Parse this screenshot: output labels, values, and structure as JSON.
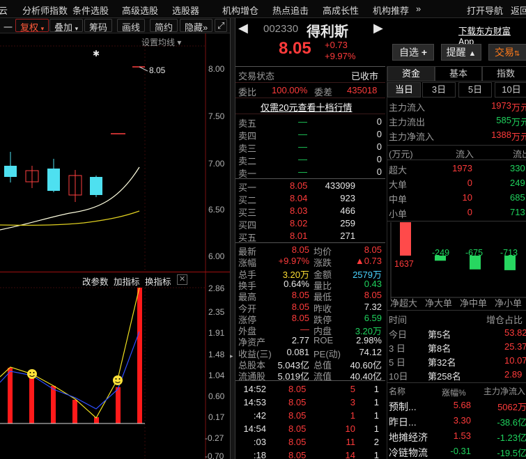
{
  "menu": {
    "items": [
      "云",
      "分析师指数",
      "条件选股",
      "高级选股",
      "选股器",
      "机构增仓",
      "热点追击",
      "高成长性",
      "机构推荐",
      "»",
      "打开导航",
      "返回"
    ]
  },
  "toolbar": {
    "buttons": [
      "复权",
      "叠加",
      "筹码",
      "画线",
      "简约",
      "隐藏"
    ],
    "first_glyph": "一",
    "expand_arrow": "»",
    "fullscreen_icon": "⤢"
  },
  "kline": {
    "setting_label": "设置均线",
    "star": "✱",
    "price_marker": "8.05",
    "y_ticks": [
      "8.00",
      "7.50",
      "7.00",
      "6.50",
      "6.00"
    ]
  },
  "indicator": {
    "buttons": [
      "改参数",
      "加指标",
      "换指标"
    ],
    "close_icon": "✕",
    "y_ticks": [
      "2.86",
      "2.35",
      "1.91",
      "1.48",
      "1.04",
      "0.60",
      "0.17",
      "-0.27",
      "-0.70"
    ]
  },
  "stock": {
    "code": "002330",
    "name": "得利斯",
    "price": "8.05",
    "change": "+0.73",
    "change_pct": "+9.97%",
    "add_watch": "自选",
    "add_watch_icon": "+",
    "remind": "提醒",
    "remind_icon": "🔔",
    "trade": "交易",
    "download_link": "下载东方财富App",
    "prev_arrow": "◀",
    "next_arrow": "▶"
  },
  "status": {
    "label": "交易状态",
    "value": "已收市",
    "weibi_label": "委比",
    "weibi": "100.00%",
    "weicha_label": "委差",
    "weicha": "435018",
    "promo": "仅需20元查看十档行情"
  },
  "asks": [
    {
      "label": "卖五",
      "price": "—",
      "vol": "0"
    },
    {
      "label": "卖四",
      "price": "—",
      "vol": "0"
    },
    {
      "label": "卖三",
      "price": "—",
      "vol": "0"
    },
    {
      "label": "卖二",
      "price": "—",
      "vol": "0"
    },
    {
      "label": "卖一",
      "price": "—",
      "vol": "0"
    }
  ],
  "bids": [
    {
      "label": "买一",
      "price": "8.05",
      "vol": "433099"
    },
    {
      "label": "买二",
      "price": "8.04",
      "vol": "923"
    },
    {
      "label": "买三",
      "price": "8.03",
      "vol": "466"
    },
    {
      "label": "买四",
      "price": "8.02",
      "vol": "259"
    },
    {
      "label": "买五",
      "price": "8.01",
      "vol": "271"
    }
  ],
  "stats": [
    {
      "l1": "最新",
      "v1": "8.05",
      "c1": "red",
      "l2": "均价",
      "v2": "8.05",
      "c2": "red"
    },
    {
      "l1": "涨幅",
      "v1": "+9.97%",
      "c1": "red",
      "l2": "涨跌",
      "v2": "▲0.73",
      "c2": "red"
    },
    {
      "l1": "总手",
      "v1": "3.20万",
      "c1": "yellow",
      "l2": "金额",
      "v2": "2579万",
      "c2": "cyan"
    },
    {
      "l1": "换手",
      "v1": "0.64%",
      "c1": "white",
      "l2": "量比",
      "v2": "0.43",
      "c2": "green"
    },
    {
      "l1": "最高",
      "v1": "8.05",
      "c1": "red",
      "l2": "最低",
      "v2": "8.05",
      "c2": "red"
    },
    {
      "l1": "今开",
      "v1": "8.05",
      "c1": "red",
      "l2": "昨收",
      "v2": "7.32",
      "c2": "white"
    },
    {
      "l1": "涨停",
      "v1": "8.05",
      "c1": "red",
      "l2": "跌停",
      "v2": "6.59",
      "c2": "green"
    },
    {
      "l1": "外盘",
      "v1": "—",
      "c1": "red",
      "l2": "内盘",
      "v2": "3.20万",
      "c2": "green"
    },
    {
      "l1": "净资产",
      "v1": "2.77",
      "c1": "white",
      "l2": "ROE",
      "v2": "2.98%",
      "c2": "white"
    },
    {
      "l1": "收益(三)",
      "v1": "0.081",
      "c1": "white",
      "l2": "PE(动)",
      "v2": "74.12",
      "c2": "white"
    },
    {
      "l1": "总股本",
      "v1": "5.043亿",
      "c1": "white",
      "l2": "总值",
      "v2": "40.60亿",
      "c2": "white"
    },
    {
      "l1": "流通股",
      "v1": "5.019亿",
      "c1": "white",
      "l2": "流值",
      "v2": "40.40亿",
      "c2": "white"
    }
  ],
  "ticks": [
    {
      "time": "14:52",
      "price": "8.05",
      "vol": "5",
      "n": "1"
    },
    {
      "time": "14:53",
      "price": "8.05",
      "vol": "3",
      "n": "1"
    },
    {
      "time": ":42",
      "price": "8.05",
      "vol": "1",
      "n": "1"
    },
    {
      "time": "14:54",
      "price": "8.05",
      "vol": "10",
      "n": "1"
    },
    {
      "time": ":03",
      "price": "8.05",
      "vol": "11",
      "n": "2"
    },
    {
      "time": ":18",
      "price": "8.05",
      "vol": "14",
      "n": "1"
    }
  ],
  "fund": {
    "tabs": [
      "资金",
      "基本",
      "指数"
    ],
    "subtabs": [
      "当日",
      "3日",
      "5日",
      "10日"
    ],
    "flows": [
      {
        "label": "主力流入",
        "value": "1973",
        "unit": "万元",
        "color": "red"
      },
      {
        "label": "主力流出",
        "value": "585",
        "unit": "万元",
        "color": "green"
      },
      {
        "label": "主力净流入",
        "value": "1388",
        "unit": "万元",
        "color": "red"
      }
    ],
    "table_head": [
      "(万元)",
      "流入",
      "流出"
    ],
    "table": [
      {
        "label": "超大",
        "in": "1973",
        "out": "330"
      },
      {
        "label": "大单",
        "in": "0",
        "out": "249"
      },
      {
        "label": "中单",
        "in": "10",
        "out": "685"
      },
      {
        "label": "小单",
        "in": "0",
        "out": "713"
      }
    ],
    "net_labels": [
      "1637",
      "-249",
      "-675",
      "-713"
    ],
    "net_values": [
      1637,
      -249,
      -675,
      -713
    ],
    "net_axis": [
      "净超大",
      "净大单",
      "净中单",
      "净小单"
    ],
    "rank_head": [
      "时间",
      "增仓占比"
    ],
    "ranks": [
      {
        "period": "今日",
        "rank": "第5名",
        "pct": "53.82"
      },
      {
        "period": "3 日",
        "rank": "第8名",
        "pct": "25.37"
      },
      {
        "period": "5 日",
        "rank": "第32名",
        "pct": "10.07"
      },
      {
        "period": "10日",
        "rank": "第258名",
        "pct": "2.89"
      }
    ],
    "sector_head": [
      "名称",
      "涨幅%",
      "主力净流入"
    ],
    "sectors": [
      {
        "name": "预制...",
        "pct": "5.68",
        "flow": "5062万",
        "color": "red"
      },
      {
        "name": "昨日...",
        "pct": "3.30",
        "flow": "-38.6亿",
        "color": "red"
      },
      {
        "name": "地摊经济",
        "pct": "1.53",
        "flow": "-1.23亿",
        "color": "red"
      },
      {
        "name": "冷链物流",
        "pct": "-0.31",
        "flow": "-19.5亿",
        "color": "green"
      }
    ]
  }
}
